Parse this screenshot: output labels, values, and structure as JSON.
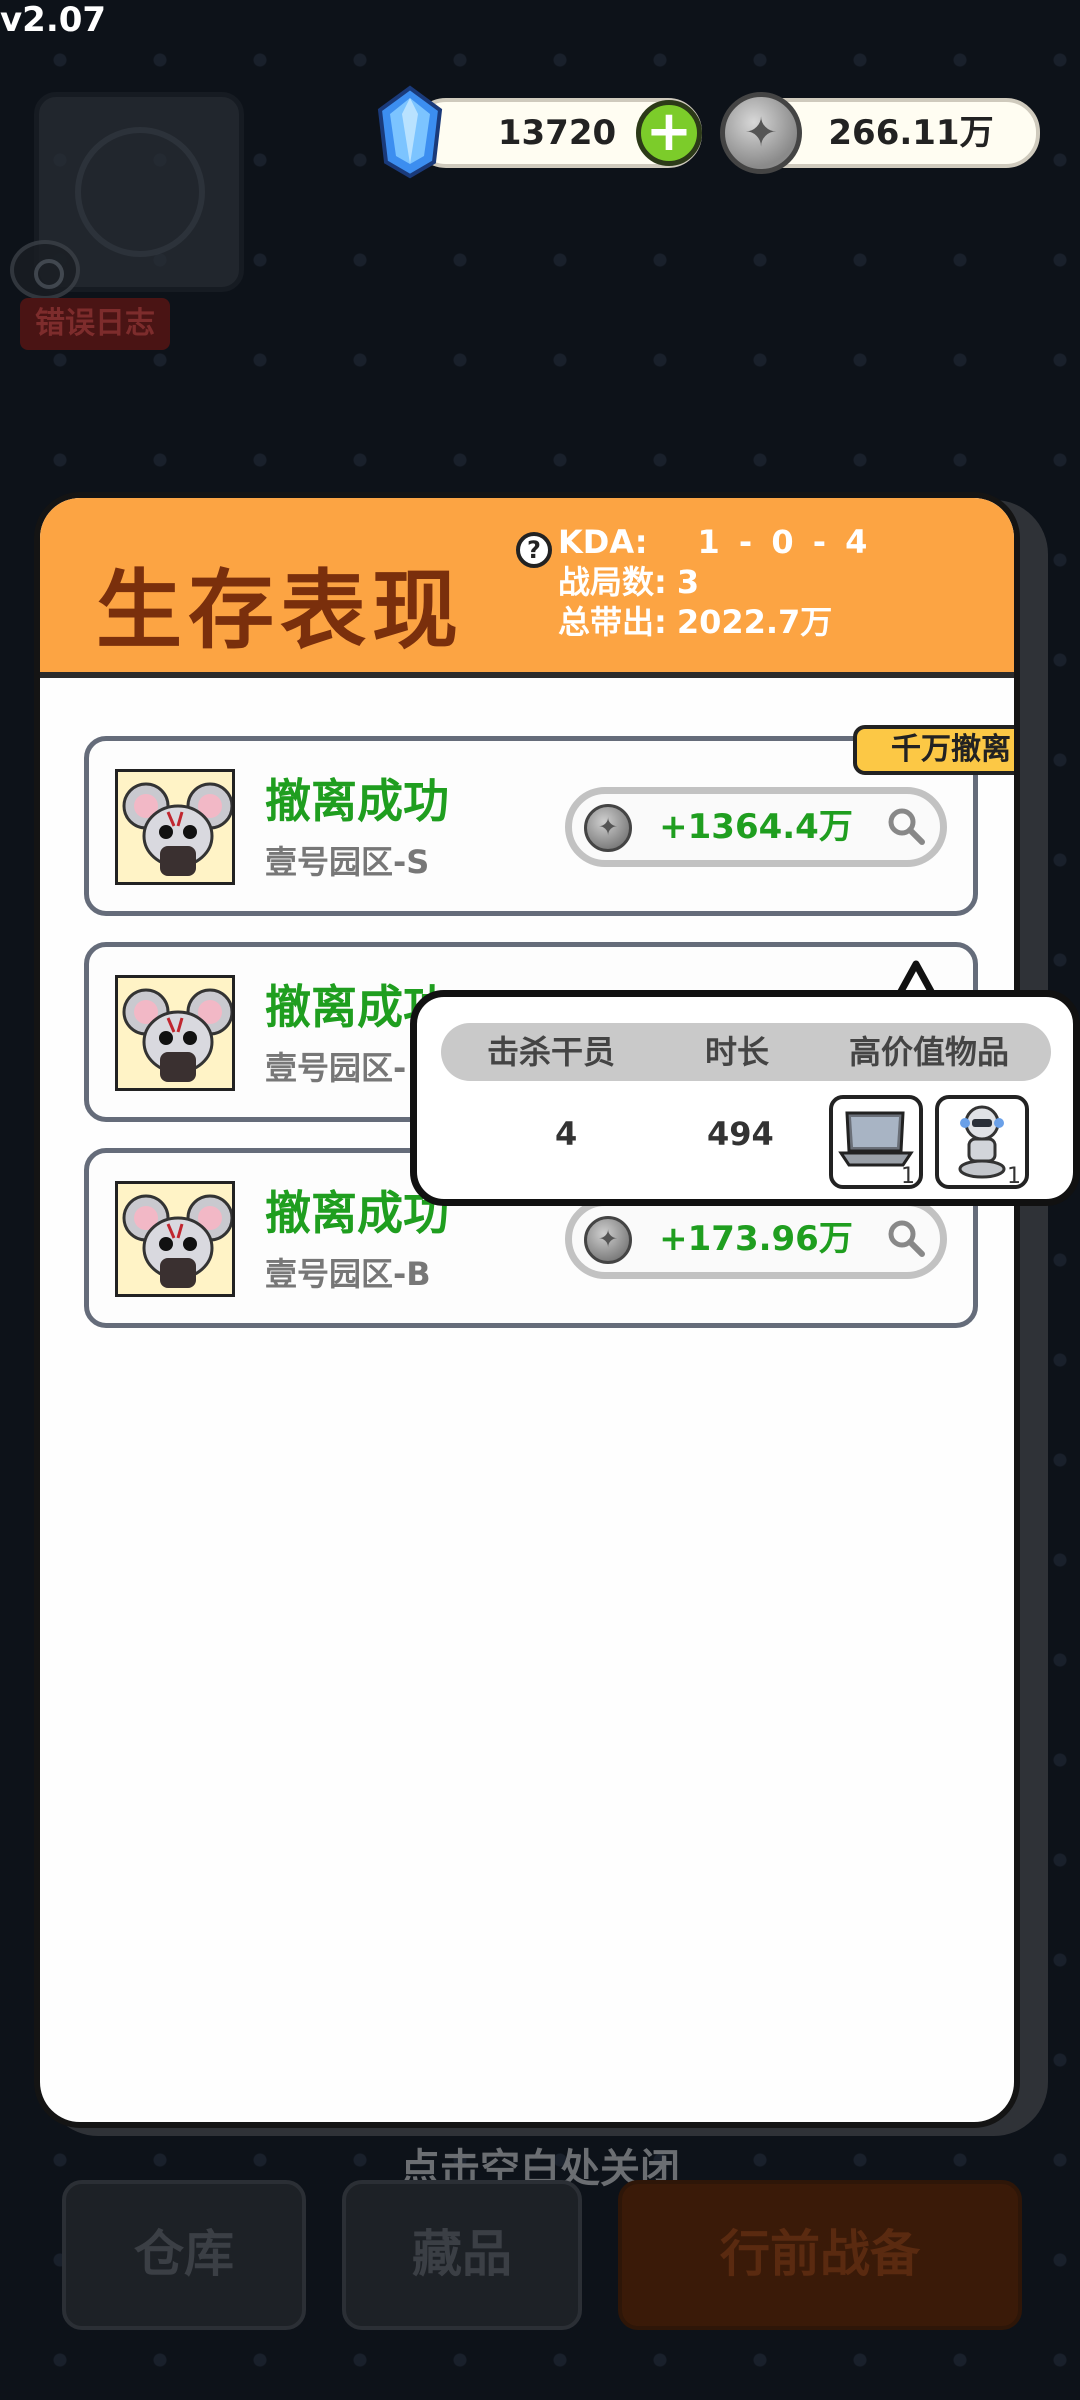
{
  "version": "v2.07",
  "background": {
    "error_log_label": "错误日志",
    "close_hint": "点击空白处关闭",
    "nav": {
      "warehouse": "仓库",
      "collection": "藏品",
      "prepare": "行前战备"
    }
  },
  "currency": {
    "gems": "13720",
    "coins": "266.11万"
  },
  "modal": {
    "title": "生存表现",
    "stats": {
      "kda_label": "KDA:",
      "kda_value": "1 - 0 - 4",
      "matches_label": "战局数:",
      "matches_value": "3",
      "total_label": "总带出:",
      "total_value": "2022.7万"
    },
    "records": [
      {
        "status": "撤离成功",
        "zone": "壹号园区-S",
        "gain": "+1364.4万",
        "badge": "千万撤离"
      },
      {
        "status": "撤离成功",
        "zone": "壹号园区-",
        "gain": ""
      },
      {
        "status": "撤离成功",
        "zone": "壹号园区-B",
        "gain": "+173.96万"
      }
    ]
  },
  "popup": {
    "headers": [
      "击杀干员",
      "时长",
      "高价值物品"
    ],
    "kills": "4",
    "duration": "494",
    "items": [
      {
        "icon": "laptop-icon",
        "count": "1"
      },
      {
        "icon": "robot-icon",
        "count": "1"
      }
    ]
  },
  "colors": {
    "header_orange": "#fca443",
    "title_brown": "#7a2f0c",
    "success_green": "#1f9e1f",
    "badge_yellow": "#fcc845"
  }
}
